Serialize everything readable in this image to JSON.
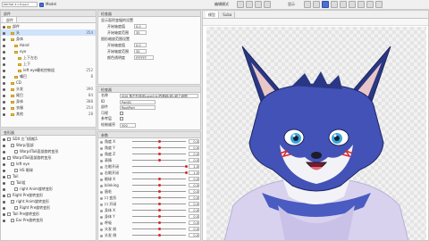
{
  "app": {
    "version": "EDITOR 4.1 Expert",
    "mode": "Model"
  },
  "toolbar": {
    "edit_mode_label": "编辑模式",
    "display_label": "显示"
  },
  "part_panel": {
    "title": "部件",
    "items": [
      {
        "label": "部件",
        "count": ""
      },
      {
        "label": "头",
        "count": "354"
      },
      {
        "label": "身体",
        "count": ""
      },
      {
        "label": "Hand",
        "count": ""
      },
      {
        "label": "eye",
        "count": ""
      },
      {
        "label": "上下左右",
        "count": ""
      },
      {
        "label": "上下",
        "count": ""
      },
      {
        "label": "left eye睫毛控制组",
        "count": "252"
      },
      {
        "label": "嘴巴",
        "count": "8"
      },
      {
        "label": "CD",
        "count": ""
      },
      {
        "label": "头发",
        "count": "390"
      },
      {
        "label": "尾巴",
        "count": "84"
      },
      {
        "label": "身体",
        "count": "388"
      },
      {
        "label": "衣服",
        "count": "254"
      },
      {
        "label": "其他",
        "count": "28"
      }
    ]
  },
  "inspector_top": {
    "title": "检查器",
    "group1_title": "显示面积变幅的设置",
    "group1_rows": [
      {
        "label": "开始轴度值",
        "value": "0.0"
      },
      {
        "label": "开始轴度范围",
        "value": "30"
      }
    ],
    "group2_title": "图形缩放范围设置",
    "group2_rows": [
      {
        "label": "开始轴度值",
        "value": "0.0"
      },
      {
        "label": "开始轴度范围",
        "value": "30"
      }
    ],
    "alpha_label": "颜色透明度",
    "alpha_value": "FFFFFF"
  },
  "inspector_mid": {
    "title": "检查器",
    "rows": [
      {
        "label": "名称",
        "value": "SDX 角左形成组Love/lnk/四格组(组)/组之组图"
      },
      {
        "label": "ID",
        "value": "PartID"
      },
      {
        "label": "部件",
        "value": "RootPart"
      },
      {
        "label": "可视",
        "value": ""
      },
      {
        "label": "参考层",
        "value": ""
      },
      {
        "label": "绘制顺序",
        "value": "500"
      }
    ]
  },
  "deformer_panel": {
    "title": "变形器",
    "items": [
      "SDX 左飞翔組1",
      "Warp/面部",
      "Warp4Tail面部旋转变形",
      "Warp4Tail面部旋转变形",
      "left eye",
      "HS 眼球",
      "Tail",
      "Tail组",
      "right Anim旋转变形",
      "Right Pre旋转变形",
      "right Anim旋转变形",
      "Right Pre旋转变形",
      "Tail Pre旋转变形",
      "Ear Pre旋转变形"
    ]
  },
  "params_panel": {
    "title": "参数",
    "items": [
      {
        "label": "角度 X",
        "value": "0.0",
        "pos": 0.5
      },
      {
        "label": "角度 Y",
        "value": "0.0",
        "pos": 0.5
      },
      {
        "label": "角度 Z",
        "value": "0.0",
        "pos": 0.5
      },
      {
        "label": "表情",
        "value": "0.0",
        "pos": 0.5
      },
      {
        "label": "左眼开闭",
        "value": "1.0",
        "pos": 1.0
      },
      {
        "label": "右眼开闭",
        "value": "1.0",
        "pos": 1.0
      },
      {
        "label": "眼球 X",
        "value": "0.0",
        "pos": 0.5
      },
      {
        "label": "blinking",
        "value": "0.0",
        "pos": 0.5
      },
      {
        "label": "眉毛",
        "value": "0.0",
        "pos": 0.5
      },
      {
        "label": "口 变形",
        "value": "0.0",
        "pos": 0.5
      },
      {
        "label": "口 开闭",
        "value": "0.0",
        "pos": 0.5
      },
      {
        "label": "身体 X",
        "value": "0.0",
        "pos": 0.5
      },
      {
        "label": "身体 Y",
        "value": "0.0",
        "pos": 0.5
      },
      {
        "label": "呼吸",
        "value": "0.0",
        "pos": 0.5
      },
      {
        "label": "头发 前",
        "value": "0.0",
        "pos": 0.5
      },
      {
        "label": "头发 侧",
        "value": "0.0",
        "pos": 0.5
      }
    ]
  },
  "canvas": {
    "tab_label": "模型",
    "file_tab": "Suba"
  },
  "colors": {
    "fur_dark": "#2a3784",
    "fur_mid": "#4352b6",
    "fur_light": "#f3f3f7",
    "hoodie": "#d8d2ee",
    "eye": "#3aa6d8",
    "accent": "#d9282f"
  }
}
